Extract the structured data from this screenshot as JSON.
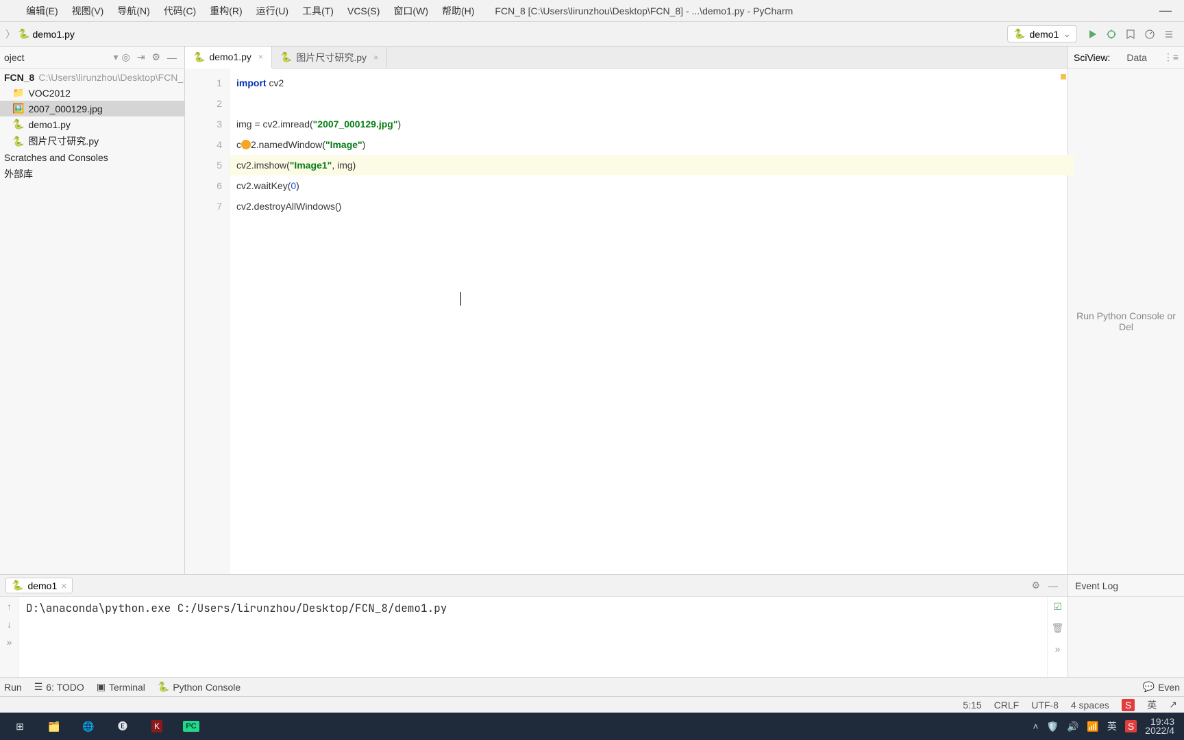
{
  "window": {
    "title": "FCN_8 [C:\\Users\\lirunzhou\\Desktop\\FCN_8] - ...\\demo1.py - PyCharm"
  },
  "menus": [
    "",
    "编辑(E)",
    "视图(V)",
    "导航(N)",
    "代码(C)",
    "重构(R)",
    "运行(U)",
    "工具(T)",
    "VCS(S)",
    "窗口(W)",
    "帮助(H)"
  ],
  "breadcrumb": {
    "items": [
      "",
      "demo1.py"
    ]
  },
  "runConfig": {
    "label": "demo1"
  },
  "sidebar": {
    "title": "oject",
    "items": [
      {
        "name": "FCN_8",
        "path": "C:\\Users\\lirunzhou\\Desktop\\FCN_...",
        "type": "root"
      },
      {
        "name": "VOC2012",
        "type": "folder"
      },
      {
        "name": "2007_000129.jpg",
        "type": "file",
        "selected": true
      },
      {
        "name": "demo1.py",
        "type": "py"
      },
      {
        "name": "图片尺寸研究.py",
        "type": "py"
      },
      {
        "name": "Scratches and Consoles",
        "type": "lib"
      },
      {
        "name": "外部库",
        "type": "lib"
      }
    ]
  },
  "editorTabs": [
    {
      "label": "demo1.py",
      "active": true
    },
    {
      "label": "图片尺寸研究.py",
      "active": false
    }
  ],
  "code": {
    "lines": [
      {
        "n": 1,
        "tokens": [
          {
            "t": "import",
            "c": "kw"
          },
          {
            "t": " cv2",
            "c": "idn"
          }
        ]
      },
      {
        "n": 2,
        "tokens": []
      },
      {
        "n": 3,
        "tokens": [
          {
            "t": "img = cv2.imread(",
            "c": "idn"
          },
          {
            "t": "\"2007_000129.jpg\"",
            "c": "str"
          },
          {
            "t": ")",
            "c": "idn"
          }
        ]
      },
      {
        "n": 4,
        "tokens": [
          {
            "t": "c",
            "c": "idn"
          },
          {
            "t": "",
            "c": "bulb"
          },
          {
            "t": "2.namedWindow(",
            "c": "idn"
          },
          {
            "t": "\"Image\"",
            "c": "str"
          },
          {
            "t": ")",
            "c": "idn"
          }
        ]
      },
      {
        "n": 5,
        "hl": true,
        "tokens": [
          {
            "t": "cv2.imshow(",
            "c": "idn"
          },
          {
            "t": "\"Image1\"",
            "c": "str"
          },
          {
            "t": ", img)",
            "c": "idn"
          }
        ]
      },
      {
        "n": 6,
        "tokens": [
          {
            "t": "cv2.waitKey(",
            "c": "idn"
          },
          {
            "t": "0",
            "c": "num"
          },
          {
            "t": ")",
            "c": "idn"
          }
        ]
      },
      {
        "n": 7,
        "tokens": [
          {
            "t": "cv2.destroyAllWindows()",
            "c": "idn"
          }
        ]
      }
    ]
  },
  "sciview": {
    "title": "SciView:",
    "tab": "Data",
    "placeholder": "Run Python Console or Del"
  },
  "run": {
    "tab": "demo1",
    "output": "D:\\anaconda\\python.exe C:/Users/lirunzhou/Desktop/FCN_8/demo1.py"
  },
  "eventLog": {
    "title": "Event Log"
  },
  "toolTabs": {
    "run": "Run",
    "todo": "6: TODO",
    "terminal": "Terminal",
    "console": "Python Console",
    "event": "Even"
  },
  "status": {
    "cursor": "5:15",
    "lineSep": "CRLF",
    "encoding": "UTF-8",
    "indent": "4 spaces"
  },
  "tray": {
    "ime1": "S",
    "ime2": "英",
    "time": "19:43",
    "date": "2022/4"
  }
}
